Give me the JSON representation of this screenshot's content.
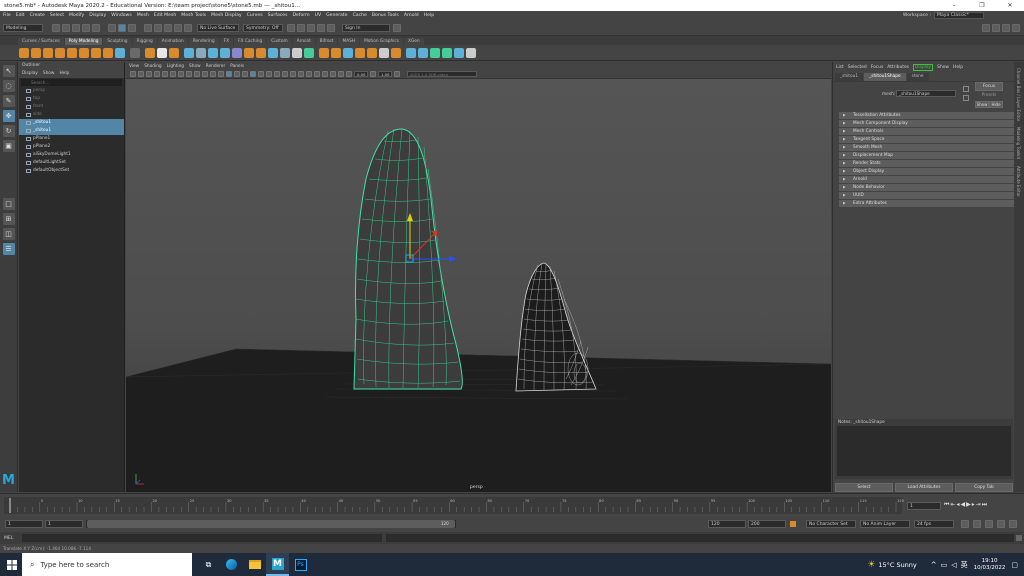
{
  "window": {
    "title": "stone5.mb* - Autodesk Maya 2020.2 - Educational Version: E:\\team project\\stone5\\stone5.mb  ---  _shitou1..."
  },
  "menubar": {
    "items": [
      "File",
      "Edit",
      "Create",
      "Select",
      "Modify",
      "Display",
      "Windows",
      "Mesh",
      "Edit Mesh",
      "Mesh Tools",
      "Mesh Display",
      "Curves",
      "Surfaces",
      "Deform",
      "UV",
      "Generate",
      "Cache",
      "Bonus Tools",
      "Arnold",
      "Help"
    ],
    "workspace_label": "Workspace :",
    "workspace_value": "Maya Classic*"
  },
  "statusline": {
    "mode": "Modeling",
    "live_surface": "No Live Surface",
    "symmetry": "Symmetry: Off",
    "sign_in": "Sign In"
  },
  "shelf": {
    "tabs": [
      "Curves / Surfaces",
      "Poly Modeling",
      "Sculpting",
      "Rigging",
      "Animation",
      "Rendering",
      "FX",
      "FX Caching",
      "Custom",
      "Arnold",
      "Bifrost",
      "MASH",
      "Motion Graphics",
      "XGen"
    ],
    "active_tab": "Poly Modeling"
  },
  "outliner": {
    "title": "Outliner",
    "menu": [
      "Display",
      "Show",
      "Help"
    ],
    "search_placeholder": "Search...",
    "rows": [
      {
        "label": "persp",
        "state": "dim"
      },
      {
        "label": "top",
        "state": "dim"
      },
      {
        "label": "front",
        "state": "dim"
      },
      {
        "label": "side",
        "state": "dim"
      },
      {
        "label": "_shitou1",
        "state": "sel"
      },
      {
        "label": "_shitou1",
        "state": "sel"
      },
      {
        "label": "pPlane1",
        "state": "normal"
      },
      {
        "label": "pPlane2",
        "state": "normal"
      },
      {
        "label": "aiSkyDomeLight1",
        "state": "normal"
      },
      {
        "label": "defaultLightSet",
        "state": "normal"
      },
      {
        "label": "defaultObjectSet",
        "state": "normal"
      }
    ]
  },
  "viewport": {
    "menu": [
      "View",
      "Shading",
      "Lighting",
      "Show",
      "Renderer",
      "Panels"
    ],
    "exposure": "0.00",
    "gamma": "1.00",
    "colorspace": "ACES 1.0 SDR-video",
    "camera_label": "persp"
  },
  "attribute_editor": {
    "menu": [
      "List",
      "Selected",
      "Focus",
      "Attributes",
      "Display",
      "Show",
      "Help"
    ],
    "tabs": [
      "_shitou1",
      "_shitou1Shape",
      "stone"
    ],
    "active_tab": "_shitou1Shape",
    "mesh_label": "mesh:",
    "mesh_value": "_shitou1Shape",
    "focus_btn": "Focus",
    "presets_btn": "Presets",
    "show_btn": "Show",
    "hide_btn": "Hide",
    "sections": [
      "Tessellation Attributes",
      "Mesh Component Display",
      "Mesh Controls",
      "Tangent Space",
      "Smooth Mesh",
      "Displacement Map",
      "Render Stats",
      "Object Display",
      "Arnold",
      "Node Behavior",
      "UUID",
      "Extra Attributes"
    ],
    "notes_label": "Notes: _shitou1Shape",
    "select_btn": "Select",
    "load_btn": "Load Attributes",
    "copy_btn": "Copy Tab",
    "side_tabs": [
      "Channel Box / Layer Editor",
      "Modeling Toolkit",
      "Attribute Editor"
    ]
  },
  "timeslider": {
    "ticks": [
      "5",
      "10",
      "15",
      "20",
      "25",
      "30",
      "35",
      "40",
      "45",
      "50",
      "55",
      "60",
      "65",
      "70",
      "75",
      "80",
      "85",
      "90",
      "95",
      "100",
      "105",
      "110",
      "115",
      "120"
    ],
    "current_frame": "1"
  },
  "rangeslider": {
    "start": "1",
    "inner_start": "1",
    "inner_end": "120",
    "end_a": "120",
    "end_b": "200",
    "char_set": "No Character Set",
    "anim_layer": "No Anim Layer",
    "fps": "24 fps"
  },
  "cmdline": {
    "label": "MEL"
  },
  "helpline": {
    "text": "Translate X Y Z(cm):  -1.464   10.086   -7.114"
  },
  "taskbar": {
    "search_placeholder": "Type here to search",
    "weather": "15°C  Sunny",
    "time": "19:10",
    "date": "10/03/2022"
  }
}
